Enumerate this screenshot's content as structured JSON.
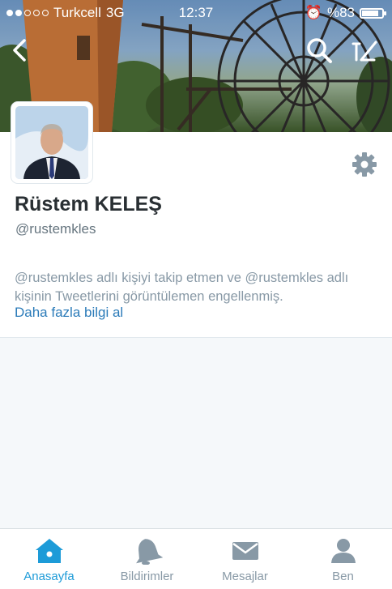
{
  "status_bar": {
    "carrier": "Turkcell",
    "network": "3G",
    "time": "12:37",
    "battery": "%83",
    "battery_level": 0.83
  },
  "profile": {
    "name": "Rüstem KELEŞ",
    "handle": "@rustemkles"
  },
  "notice": {
    "blocked_message": "@rustemkles adlı kişiyi takip etmen ve @rustemkles adlı kişinin Tweetlerini görüntülemen engellenmiş.",
    "learn_more": "Daha fazla bilgi al"
  },
  "header_icons": [
    "back-chevron-icon",
    "search-icon",
    "compose-tweet-icon"
  ],
  "tabs": [
    {
      "label": "Anasayfa",
      "icon": "home-icon",
      "active": true
    },
    {
      "label": "Bildirimler",
      "icon": "bell-icon",
      "active": false
    },
    {
      "label": "Mesajlar",
      "icon": "envelope-icon",
      "active": false
    },
    {
      "label": "Ben",
      "icon": "person-icon",
      "active": false
    }
  ],
  "colors": {
    "accent": "#1d9bd8",
    "link": "#2b7bb9",
    "muted_text": "#8899a6",
    "name_text": "#292f33"
  }
}
